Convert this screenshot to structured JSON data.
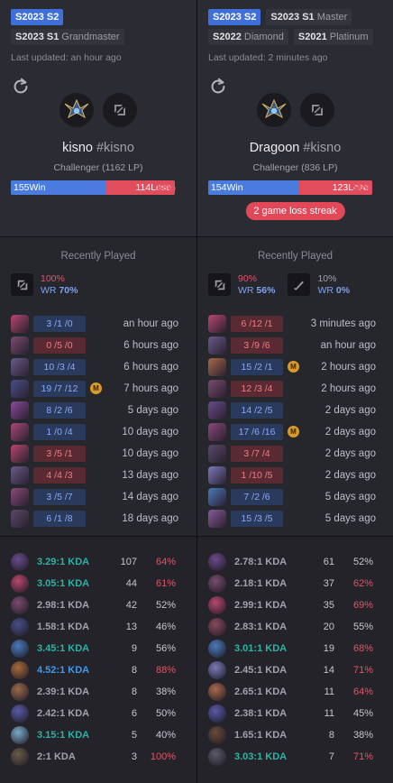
{
  "players": [
    {
      "badges": [
        {
          "season": "S2023 S2",
          "active": true
        },
        {
          "season": "S2023 S1",
          "tier": "Grandmaster"
        }
      ],
      "updated": "Last updated: an hour ago",
      "name": "kisno",
      "tag": "#kisno",
      "rank": "Challenger (1162 LP)",
      "wins": "155Win",
      "losses": "114Lose",
      "win_fraction": 0.576,
      "winrate": "58%",
      "streak": "",
      "recent_title": "Recently Played",
      "roles": [
        {
          "percent": "100%",
          "wr_label": "WR",
          "wr": "70%",
          "icon": "mid-lane-icon"
        }
      ],
      "games": [
        {
          "kda": "3 /1 /0",
          "result": "win",
          "mvp": false,
          "time": "an hour ago",
          "color": "#b8476e"
        },
        {
          "kda": "0 /5 /0",
          "result": "loss",
          "mvp": false,
          "time": "6 hours ago",
          "color": "#7a4b6e"
        },
        {
          "kda": "10 /3 /4",
          "result": "win",
          "mvp": false,
          "time": "6 hours ago",
          "color": "#6a5a8a"
        },
        {
          "kda": "19 /7 /12",
          "result": "win",
          "mvp": true,
          "time": "7 hours ago",
          "color": "#4a4f8a"
        },
        {
          "kda": "8 /2 /6",
          "result": "win",
          "mvp": false,
          "time": "5 days ago",
          "color": "#8a4a9a"
        },
        {
          "kda": "1 /0 /4",
          "result": "win",
          "mvp": false,
          "time": "10 days ago",
          "color": "#a84a7a"
        },
        {
          "kda": "3 /5 /1",
          "result": "loss",
          "mvp": false,
          "time": "10 days ago",
          "color": "#b8476e"
        },
        {
          "kda": "4 /4 /3",
          "result": "loss",
          "mvp": false,
          "time": "13 days ago",
          "color": "#6a5a8a"
        },
        {
          "kda": "3 /5 /7",
          "result": "win",
          "mvp": false,
          "time": "14 days ago",
          "color": "#8a4a7a"
        },
        {
          "kda": "6 /1 /8",
          "result": "win",
          "mvp": false,
          "time": "18 days ago",
          "color": "#5a4a6a"
        }
      ],
      "champ_stats": [
        {
          "kda": "3.29:1 KDA",
          "kda_style": "hi",
          "games": "107",
          "wr": "64%",
          "wr_red": true,
          "color": "#6a4a8a"
        },
        {
          "kda": "3.05:1 KDA",
          "kda_style": "hi",
          "games": "44",
          "wr": "61%",
          "wr_red": true,
          "color": "#b8476e"
        },
        {
          "kda": "2.98:1 KDA",
          "kda_style": "",
          "games": "42",
          "wr": "52%",
          "wr_red": false,
          "color": "#7a4b6e"
        },
        {
          "kda": "1.58:1 KDA",
          "kda_style": "",
          "games": "13",
          "wr": "46%",
          "wr_red": false,
          "color": "#4a4f8a"
        },
        {
          "kda": "3.45:1 KDA",
          "kda_style": "hi",
          "games": "9",
          "wr": "56%",
          "wr_red": false,
          "color": "#4a7aba"
        },
        {
          "kda": "4.52:1 KDA",
          "kda_style": "blue",
          "games": "8",
          "wr": "88%",
          "wr_red": true,
          "color": "#a86a3a"
        },
        {
          "kda": "2.39:1 KDA",
          "kda_style": "",
          "games": "8",
          "wr": "38%",
          "wr_red": false,
          "color": "#9a6a4a"
        },
        {
          "kda": "2.42:1 KDA",
          "kda_style": "",
          "games": "6",
          "wr": "50%",
          "wr_red": false,
          "color": "#5a5aa8"
        },
        {
          "kda": "3.15:1 KDA",
          "kda_style": "hi",
          "games": "5",
          "wr": "40%",
          "wr_red": false,
          "color": "#7aa8c8"
        },
        {
          "kda": "2:1 KDA",
          "kda_style": "",
          "games": "3",
          "wr": "100%",
          "wr_red": true,
          "color": "#6a5a4a"
        }
      ]
    },
    {
      "badges": [
        {
          "season": "S2023 S2",
          "active": true
        },
        {
          "season": "S2023 S1",
          "tier": "Master"
        },
        {
          "season": "S2022",
          "tier": "Diamond"
        },
        {
          "season": "S2021",
          "tier": "Platinum"
        }
      ],
      "updated": "Last updated: 2 minutes ago",
      "name": "Dragoon",
      "tag": "#kisno",
      "rank": "Challenger (836 LP)",
      "wins": "154Win",
      "losses": "123Lose",
      "win_fraction": 0.556,
      "winrate": "56%",
      "streak": "2 game loss streak",
      "recent_title": "Recently Played",
      "roles": [
        {
          "percent": "90%",
          "wr_label": "WR",
          "wr": "56%",
          "icon": "mid-lane-icon"
        },
        {
          "percent": "10%",
          "wr_label": "WR",
          "wr": "0%",
          "icon": "jungle-icon"
        }
      ],
      "games": [
        {
          "kda": "6 /12 /1",
          "result": "loss",
          "mvp": false,
          "time": "3 minutes ago",
          "color": "#b8476e"
        },
        {
          "kda": "3 /9 /6",
          "result": "loss",
          "mvp": false,
          "time": "an hour ago",
          "color": "#6a5a8a"
        },
        {
          "kda": "15 /2 /1",
          "result": "win",
          "mvp": true,
          "time": "2 hours ago",
          "color": "#a86a4a"
        },
        {
          "kda": "12 /3 /4",
          "result": "loss",
          "mvp": false,
          "time": "2 hours ago",
          "color": "#7a4b6e"
        },
        {
          "kda": "14 /2 /5",
          "result": "win",
          "mvp": false,
          "time": "2 days ago",
          "color": "#6a4a8a"
        },
        {
          "kda": "17 /6 /16",
          "result": "win",
          "mvp": true,
          "time": "2 days ago",
          "color": "#8a4a7a"
        },
        {
          "kda": "3 /7 /4",
          "result": "loss",
          "mvp": false,
          "time": "2 days ago",
          "color": "#5a4a6a"
        },
        {
          "kda": "1 /10 /5",
          "result": "loss",
          "mvp": false,
          "time": "2 days ago",
          "color": "#7a7ab8"
        },
        {
          "kda": "7 /2 /6",
          "result": "win",
          "mvp": false,
          "time": "5 days ago",
          "color": "#4a7aba"
        },
        {
          "kda": "15 /3 /5",
          "result": "win",
          "mvp": false,
          "time": "5 days ago",
          "color": "#8a5a9a"
        }
      ],
      "champ_stats": [
        {
          "kda": "2.78:1 KDA",
          "kda_style": "",
          "games": "61",
          "wr": "52%",
          "wr_red": false,
          "color": "#6a4a8a"
        },
        {
          "kda": "2.18:1 KDA",
          "kda_style": "",
          "games": "37",
          "wr": "62%",
          "wr_red": true,
          "color": "#7a4b6e"
        },
        {
          "kda": "2.99:1 KDA",
          "kda_style": "",
          "games": "35",
          "wr": "69%",
          "wr_red": true,
          "color": "#b8476e"
        },
        {
          "kda": "2.83:1 KDA",
          "kda_style": "",
          "games": "20",
          "wr": "55%",
          "wr_red": false,
          "color": "#8a4a5a"
        },
        {
          "kda": "3.01:1 KDA",
          "kda_style": "hi",
          "games": "19",
          "wr": "68%",
          "wr_red": true,
          "color": "#4a7aba"
        },
        {
          "kda": "2.45:1 KDA",
          "kda_style": "",
          "games": "14",
          "wr": "71%",
          "wr_red": true,
          "color": "#7a7ab8"
        },
        {
          "kda": "2.65:1 KDA",
          "kda_style": "",
          "games": "11",
          "wr": "64%",
          "wr_red": true,
          "color": "#a86a4a"
        },
        {
          "kda": "2.38:1 KDA",
          "kda_style": "",
          "games": "11",
          "wr": "45%",
          "wr_red": false,
          "color": "#5a5aa8"
        },
        {
          "kda": "1.65:1 KDA",
          "kda_style": "",
          "games": "8",
          "wr": "38%",
          "wr_red": false,
          "color": "#6a4a3a"
        },
        {
          "kda": "3.03:1 KDA",
          "kda_style": "hi",
          "games": "7",
          "wr": "71%",
          "wr_red": true,
          "color": "#5a5a6a"
        }
      ]
    }
  ]
}
